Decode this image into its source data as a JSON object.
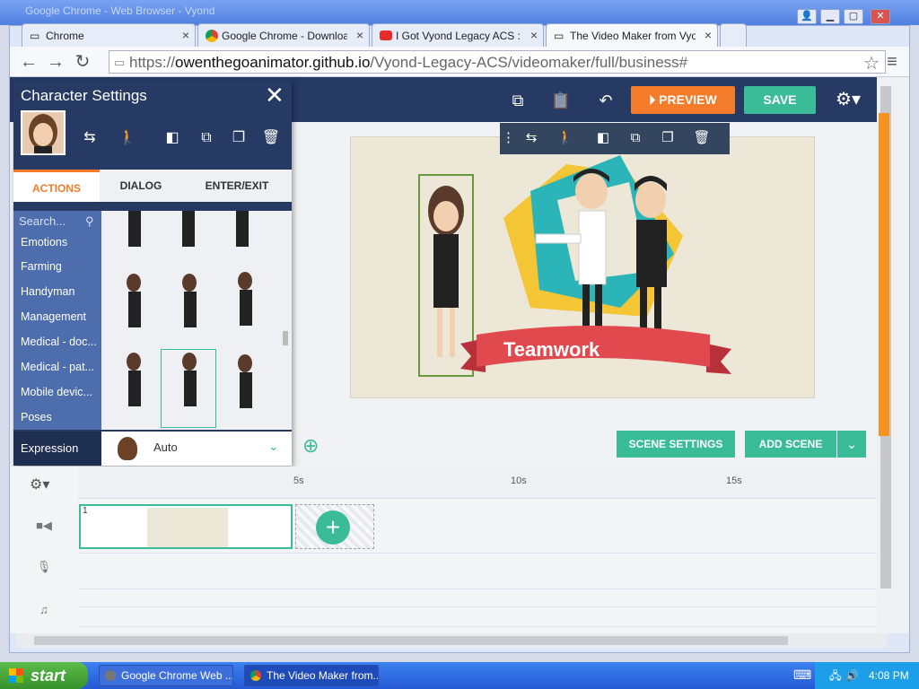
{
  "window": {
    "title": "Google Chrome - Web Browser - Vyond"
  },
  "tabs": [
    {
      "label": "Chrome",
      "icon": "document-icon"
    },
    {
      "label": "Google Chrome - Download t",
      "icon": "chrome-logo-icon"
    },
    {
      "label": "I Got Vyond Legacy ACS :D (",
      "icon": "youtube-icon"
    },
    {
      "label": "The Video Maker from Vyond",
      "icon": "document-icon",
      "active": true
    }
  ],
  "address": {
    "scheme": "https://",
    "domain": "owenthegoanimator.github.io",
    "path": "/Vyond-Legacy-ACS/videomaker/full/business#"
  },
  "header": {
    "preview_label": "PREVIEW",
    "save_label": "SAVE"
  },
  "panel": {
    "title": "Character Settings",
    "tabs": [
      "ACTIONS",
      "DIALOG",
      "ENTER/EXIT"
    ],
    "search_placeholder": "Search...",
    "categories": [
      "Emotions",
      "Farming",
      "Handyman",
      "Management",
      "Medical - doc...",
      "Medical - pat...",
      "Mobile devic...",
      "Poses"
    ],
    "expression_label": "Expression",
    "expression_value": "Auto"
  },
  "stage": {
    "banner_text": "Teamwork",
    "scene_settings_label": "SCENE SETTINGS",
    "add_scene_label": "ADD SCENE"
  },
  "timeline": {
    "marks": [
      "5s",
      "10s",
      "15s"
    ],
    "scene_number": "1"
  },
  "taskbar": {
    "start_label": "start",
    "tasks": [
      "Google Chrome Web ...",
      "The Video Maker from..."
    ],
    "time": "4:08 PM"
  },
  "colors": {
    "accent": "#3bbc99",
    "preview": "#f47b2a",
    "header": "#273a64"
  }
}
